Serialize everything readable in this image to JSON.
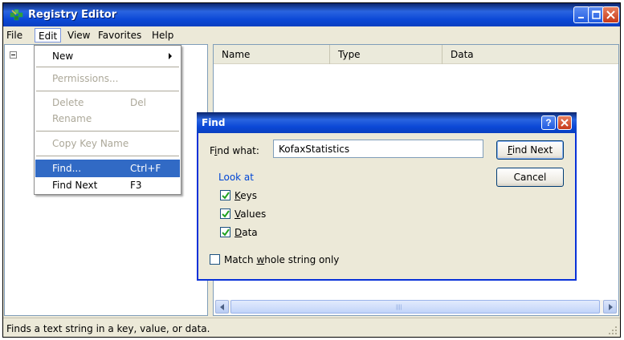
{
  "window": {
    "title": "Registry Editor"
  },
  "menubar": {
    "items": [
      "File",
      "Edit",
      "View",
      "Favorites",
      "Help"
    ]
  },
  "list": {
    "columns": [
      "Name",
      "Type",
      "Data"
    ]
  },
  "edit_menu": {
    "items": [
      {
        "label": "New",
        "shortcut": "",
        "state": "enabled",
        "submenu": true
      },
      {
        "label": "Permissions...",
        "shortcut": "",
        "state": "disabled"
      },
      {
        "label": "Delete",
        "shortcut": "Del",
        "state": "disabled"
      },
      {
        "label": "Rename",
        "shortcut": "",
        "state": "disabled"
      },
      {
        "label": "Copy Key Name",
        "shortcut": "",
        "state": "disabled"
      },
      {
        "label": "Find...",
        "shortcut": "Ctrl+F",
        "state": "selected"
      },
      {
        "label": "Find Next",
        "shortcut": "F3",
        "state": "enabled"
      }
    ]
  },
  "find_dialog": {
    "title": "Find",
    "help_glyph": "?",
    "find_what_prefix": "F",
    "find_what_mnemonic": "i",
    "find_what_suffix": "nd what:",
    "find_what_value": "KofaxStatistics",
    "find_next_mnemonic": "F",
    "find_next_rest": "ind Next",
    "cancel_label": "Cancel",
    "look_at_label": "Look at",
    "checkboxes": [
      {
        "mnemonic": "K",
        "rest": "eys",
        "checked": true
      },
      {
        "mnemonic": "V",
        "rest": "alues",
        "checked": true
      },
      {
        "mnemonic": "D",
        "rest": "ata",
        "checked": true
      }
    ],
    "match_prefix": "Match ",
    "match_mnemonic": "w",
    "match_suffix": "hole string only",
    "match_checked": false
  },
  "statusbar": {
    "text": "Finds a text string in a key, value, or data."
  },
  "colors": {
    "titlebar": "#0b48d6",
    "selection": "#316ac5",
    "lookat": "#0046d5"
  }
}
